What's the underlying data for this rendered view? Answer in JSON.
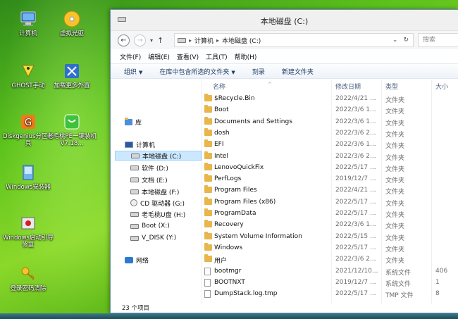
{
  "desktop": {
    "icons": [
      {
        "label": "计算机"
      },
      {
        "label": "虚拟光驱"
      },
      {
        "label": "GHOST手动"
      },
      {
        "label": "加载更多外置"
      },
      {
        "label": "Diskgenius分区工具"
      },
      {
        "label": "老毛桃PE一键装机 V7.18..."
      },
      {
        "label": "Windows安装器"
      },
      {
        "label": "Windows启动引导修复"
      },
      {
        "label": "登录密码清除"
      }
    ]
  },
  "window": {
    "title": "本地磁盘 (C:)",
    "address": {
      "segments": [
        "计算机",
        "本地磁盘 (C:)"
      ],
      "search_placeholder": "搜索"
    },
    "menu": [
      "文件(F)",
      "编辑(E)",
      "查看(V)",
      "工具(T)",
      "帮助(H)"
    ],
    "toolbar": [
      {
        "label": "组织",
        "dropdown": true
      },
      {
        "label": "在库中包含所选的文件夹",
        "dropdown": true
      },
      {
        "label": "刻录",
        "dropdown": false
      },
      {
        "label": "新建文件夹",
        "dropdown": false
      }
    ],
    "nav": {
      "library": "库",
      "computer": "计算机",
      "drives": [
        {
          "label": "本地磁盘 (C:)",
          "selected": true
        },
        {
          "label": "软件 (D:)"
        },
        {
          "label": "文档 (E:)"
        },
        {
          "label": "本地磁盘 (F:)"
        },
        {
          "label": "CD 驱动器 (G:)"
        },
        {
          "label": "老毛桃U盘 (H:)"
        },
        {
          "label": "Boot (X:)"
        },
        {
          "label": "V_DISK (Y:)"
        }
      ],
      "network": "网络"
    },
    "columns": {
      "name": "名称",
      "date": "修改日期",
      "type": "类型",
      "size": "大小"
    },
    "files": [
      {
        "name": "$Recycle.Bin",
        "date": "2022/4/21 ...",
        "type": "文件夹",
        "size": "",
        "kind": "folder"
      },
      {
        "name": "Boot",
        "date": "2022/3/6 1...",
        "type": "文件夹",
        "size": "",
        "kind": "folder"
      },
      {
        "name": "Documents and Settings",
        "date": "2022/3/6 1...",
        "type": "文件夹",
        "size": "",
        "kind": "folder"
      },
      {
        "name": "dosh",
        "date": "2022/3/6 2...",
        "type": "文件夹",
        "size": "",
        "kind": "folder"
      },
      {
        "name": "EFI",
        "date": "2022/3/6 1...",
        "type": "文件夹",
        "size": "",
        "kind": "folder"
      },
      {
        "name": "Intel",
        "date": "2022/3/6 2...",
        "type": "文件夹",
        "size": "",
        "kind": "folder"
      },
      {
        "name": "LenovoQuickFix",
        "date": "2022/5/17 ...",
        "type": "文件夹",
        "size": "",
        "kind": "folder"
      },
      {
        "name": "PerfLogs",
        "date": "2019/12/7 ...",
        "type": "文件夹",
        "size": "",
        "kind": "folder"
      },
      {
        "name": "Program Files",
        "date": "2022/4/21 ...",
        "type": "文件夹",
        "size": "",
        "kind": "folder"
      },
      {
        "name": "Program Files (x86)",
        "date": "2022/5/17 ...",
        "type": "文件夹",
        "size": "",
        "kind": "folder"
      },
      {
        "name": "ProgramData",
        "date": "2022/5/17 ...",
        "type": "文件夹",
        "size": "",
        "kind": "folder"
      },
      {
        "name": "Recovery",
        "date": "2022/3/6 1...",
        "type": "文件夹",
        "size": "",
        "kind": "folder"
      },
      {
        "name": "System Volume Information",
        "date": "2022/5/15 ...",
        "type": "文件夹",
        "size": "",
        "kind": "folder"
      },
      {
        "name": "Windows",
        "date": "2022/5/17 ...",
        "type": "文件夹",
        "size": "",
        "kind": "folder"
      },
      {
        "name": "用户",
        "date": "2022/3/6 2...",
        "type": "文件夹",
        "size": "",
        "kind": "folder"
      },
      {
        "name": "bootmgr",
        "date": "2021/12/10...",
        "type": "系统文件",
        "size": "406",
        "kind": "file"
      },
      {
        "name": "BOOTNXT",
        "date": "2019/12/7 ...",
        "type": "系统文件",
        "size": "1",
        "kind": "file"
      },
      {
        "name": "DumpStack.log.tmp",
        "date": "2022/5/17 ...",
        "type": "TMP 文件",
        "size": "8",
        "kind": "file"
      }
    ],
    "status": "23 个项目"
  }
}
